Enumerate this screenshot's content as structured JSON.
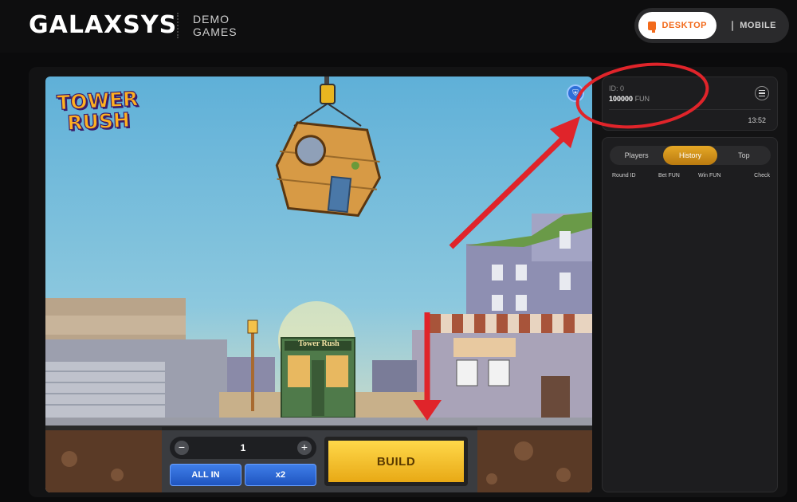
{
  "header": {
    "brand": "GALAXSYS",
    "demo_line1": "DEMO",
    "demo_line2": "GAMES",
    "mode_desktop": "DESKTOP",
    "mode_mobile": "MOBILE"
  },
  "game": {
    "logo_line1": "TOWER",
    "logo_line2": "RUSH",
    "shop_sign": "Tower Rush",
    "quantity": "1",
    "minus_label": "−",
    "plus_label": "+",
    "all_in_label": "ALL IN",
    "x2_label": "x2",
    "build_label": "BUILD"
  },
  "account": {
    "id_label": "ID: 0",
    "balance": "100000",
    "currency": "FUN",
    "time": "13:52"
  },
  "history": {
    "tabs": [
      "Players",
      "History",
      "Top"
    ],
    "active_tab": "History",
    "columns": [
      "Round ID",
      "Bet  FUN",
      "Win  FUN",
      "Check"
    ]
  },
  "colors": {
    "accent_orange": "#f26a1b",
    "annotation_red": "#e0242a",
    "build_gold": "#f5c430"
  },
  "icons": [
    "monitor-icon",
    "phone-icon",
    "shield-icon",
    "menu-icon"
  ]
}
